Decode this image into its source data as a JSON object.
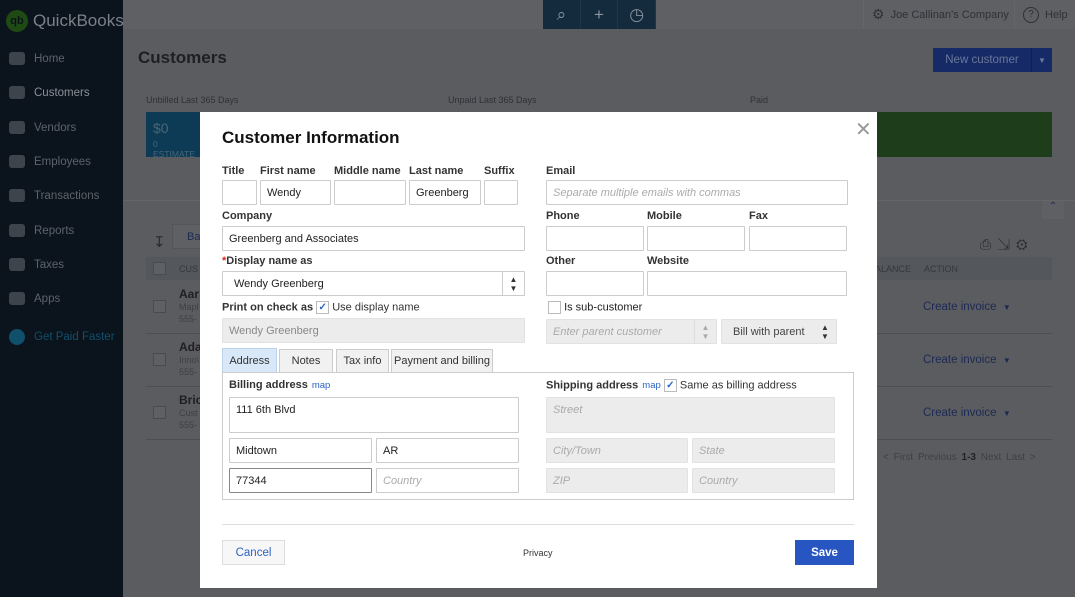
{
  "app": {
    "name": "QuickBooks",
    "logo_text": "qb"
  },
  "sidebar": {
    "items": [
      {
        "label": "Home"
      },
      {
        "label": "Customers"
      },
      {
        "label": "Vendors"
      },
      {
        "label": "Employees"
      },
      {
        "label": "Transactions"
      },
      {
        "label": "Reports"
      },
      {
        "label": "Taxes"
      },
      {
        "label": "Apps"
      },
      {
        "label": "Get Paid Faster"
      }
    ]
  },
  "topbar": {
    "company": "Joe Callinan's Company",
    "help": "Help",
    "icons": [
      "search-icon",
      "plus-icon",
      "recent-icon"
    ]
  },
  "page": {
    "title": "Customers",
    "new_customer": "New customer",
    "summary": {
      "unbilled": "Unbilled Last 365 Days",
      "unpaid": "Unpaid Last 365 Days",
      "paid": "Paid",
      "unbilled_amount": "$0",
      "unbilled_sub": "0 ESTIMATE"
    },
    "batch": "Ba",
    "table": {
      "headers": {
        "customer": "CUS",
        "balance": "ALANCE",
        "action": "ACTION"
      },
      "rows": [
        {
          "name": "Aar",
          "company": "Mapl",
          "phone": "555-",
          "action": "Create invoice"
        },
        {
          "name": "Ada",
          "company": "Inno\\",
          "phone": "555-",
          "action": "Create invoice"
        },
        {
          "name": "Bric",
          "company": "Cust",
          "phone": "555-",
          "action": "Create invoice"
        }
      ]
    },
    "pager": {
      "first": "< First",
      "previous": "Previous",
      "range": "1-3",
      "next": "Next",
      "last": "Last >"
    }
  },
  "modal": {
    "title": "Customer Information",
    "labels": {
      "title": "Title",
      "first": "First name",
      "middle": "Middle name",
      "last": "Last name",
      "suffix": "Suffix",
      "company": "Company",
      "display": "Display name as",
      "print": "Print on check as",
      "use_display": "Use display name",
      "email": "Email",
      "phone": "Phone",
      "mobile": "Mobile",
      "fax": "Fax",
      "other": "Other",
      "website": "Website",
      "sub": "Is sub-customer"
    },
    "values": {
      "title": "",
      "first": "Wendy",
      "middle": "",
      "last": "Greenberg",
      "suffix": "",
      "company": "Greenberg and Associates",
      "display": "Wendy Greenberg",
      "print": "Wendy Greenberg",
      "bill_with": "Bill with parent"
    },
    "placeholders": {
      "email": "Separate multiple emails with commas",
      "parent": "Enter parent customer"
    },
    "checks": {
      "use_display": true,
      "sub_customer": false,
      "same_as_billing": true
    },
    "tabs": [
      {
        "label": "Address",
        "active": true
      },
      {
        "label": "Notes"
      },
      {
        "label": "Tax info"
      },
      {
        "label": "Payment and billing"
      }
    ],
    "billing": {
      "label": "Billing address",
      "map": "map",
      "street": "111 6th Blvd",
      "city": "Midtown",
      "state": "AR",
      "zip": "77344",
      "country_ph": "Country"
    },
    "shipping": {
      "label": "Shipping address",
      "map": "map",
      "same": "Same as billing address",
      "street_ph": "Street",
      "city_ph": "City/Town",
      "state_ph": "State",
      "zip_ph": "ZIP",
      "country_ph": "Country"
    },
    "footer": {
      "cancel": "Cancel",
      "privacy": "Privacy",
      "save": "Save"
    }
  },
  "colors": {
    "primary": "#2756c3",
    "link": "#2b63c6",
    "required": "#d52b1e"
  }
}
